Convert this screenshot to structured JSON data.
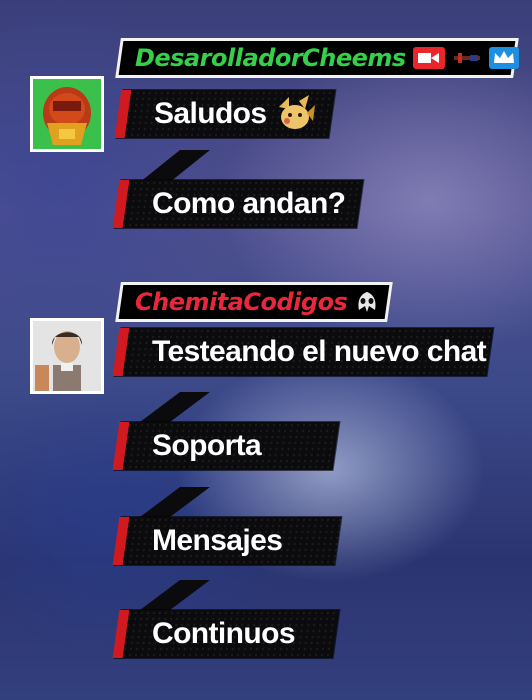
{
  "groups": [
    {
      "username": "DesarolladorCheems",
      "username_color": "#35d04a",
      "badges": [
        "video-camera-icon",
        "sword-icon",
        "crown-icon"
      ],
      "messages": [
        "Saludos",
        "Como andan?"
      ],
      "message_emotes": [
        "pikachu-emote",
        ""
      ]
    },
    {
      "username": "ChemitaCodigos",
      "username_color": "#e8283a",
      "badges": [
        "moth-icon"
      ],
      "messages": [
        "Testeando el nuevo chat",
        "Soporta",
        "Mensajes",
        "Continuos"
      ],
      "message_emotes": [
        "",
        "",
        "",
        ""
      ]
    }
  ]
}
